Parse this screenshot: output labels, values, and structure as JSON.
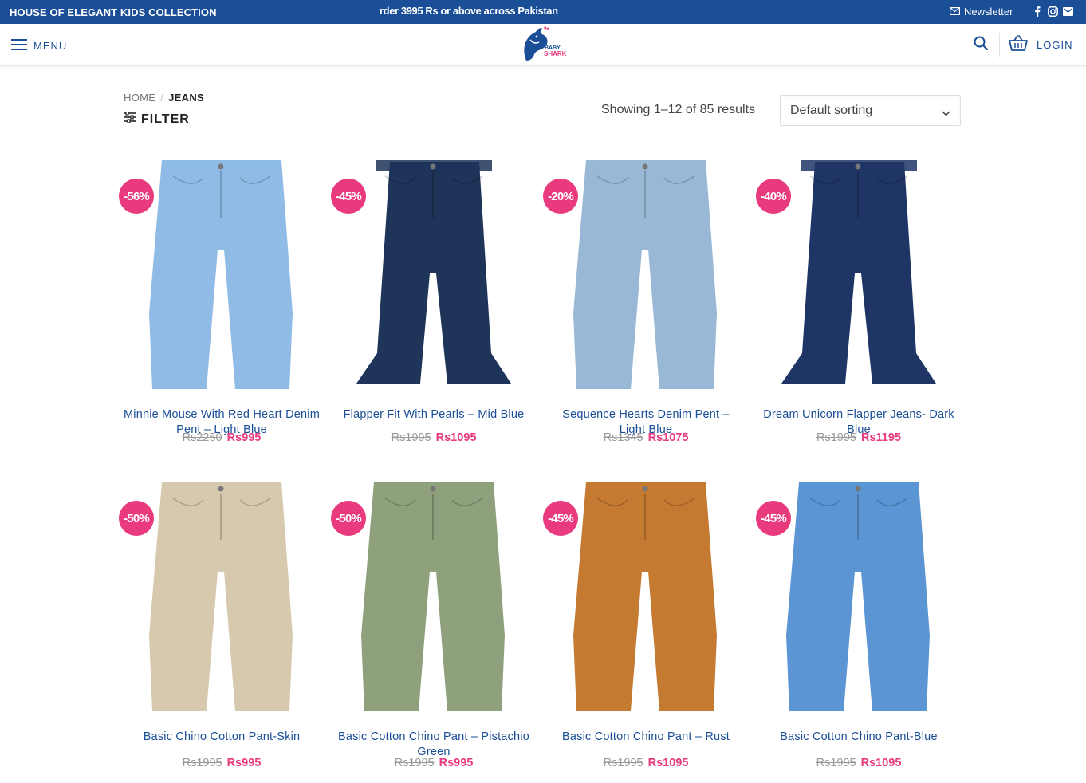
{
  "topbar": {
    "tagline": "HOUSE OF ELEGANT KIDS COLLECTION",
    "marquee": "rder 3995 Rs or above across Pakistan",
    "newsletter": "Newsletter",
    "social_icons": [
      "facebook-icon",
      "instagram-icon",
      "email-icon"
    ]
  },
  "header": {
    "menu_label": "MENU",
    "logo_line1": "BABY",
    "logo_line2": "SHARK",
    "login_label": "LOGIN"
  },
  "breadcrumb": {
    "home": "HOME",
    "separator": "/",
    "current": "JEANS"
  },
  "filter_label": "FILTER",
  "results_text": "Showing 1–12 of 85 results",
  "sort": {
    "selected": "Default sorting"
  },
  "colors": {
    "brand_blue": "#1a4e97",
    "accent_pink": "#e93a7d"
  },
  "products": [
    {
      "badge": "-56%",
      "title": "Minnie Mouse With Red Heart Denim Pent – Light Blue",
      "currency": "Rs",
      "old_price": "2250",
      "new_price": "995",
      "color": "#8fbbe6"
    },
    {
      "badge": "-45%",
      "title": "Flapper Fit With Pearls – Mid Blue",
      "currency": "Rs",
      "old_price": "1995",
      "new_price": "1095",
      "color": "#1f3459"
    },
    {
      "badge": "-20%",
      "title": "Sequence Hearts Denim Pent – Light Blue",
      "currency": "Rs",
      "old_price": "1345",
      "new_price": "1075",
      "color": "#98b8d6"
    },
    {
      "badge": "-40%",
      "title": "Dream Unicorn Flapper Jeans- Dark Blue",
      "currency": "Rs",
      "old_price": "1995",
      "new_price": "1195",
      "color": "#1e3566"
    },
    {
      "badge": "-50%",
      "title": "Basic Chino Cotton Pant-Skin",
      "currency": "Rs",
      "old_price": "1995",
      "new_price": "995",
      "color": "#d7c9ae"
    },
    {
      "badge": "-50%",
      "title": "Basic Cotton Chino Pant – Pistachio Green",
      "currency": "Rs",
      "old_price": "1995",
      "new_price": "995",
      "color": "#8fa07c"
    },
    {
      "badge": "-45%",
      "title": "Basic Cotton Chino Pant – Rust",
      "currency": "Rs",
      "old_price": "1995",
      "new_price": "1095",
      "color": "#c57a31"
    },
    {
      "badge": "-45%",
      "title": "Basic Cotton Chino Pant-Blue",
      "currency": "Rs",
      "old_price": "1995",
      "new_price": "1095",
      "color": "#5b95d3"
    }
  ]
}
